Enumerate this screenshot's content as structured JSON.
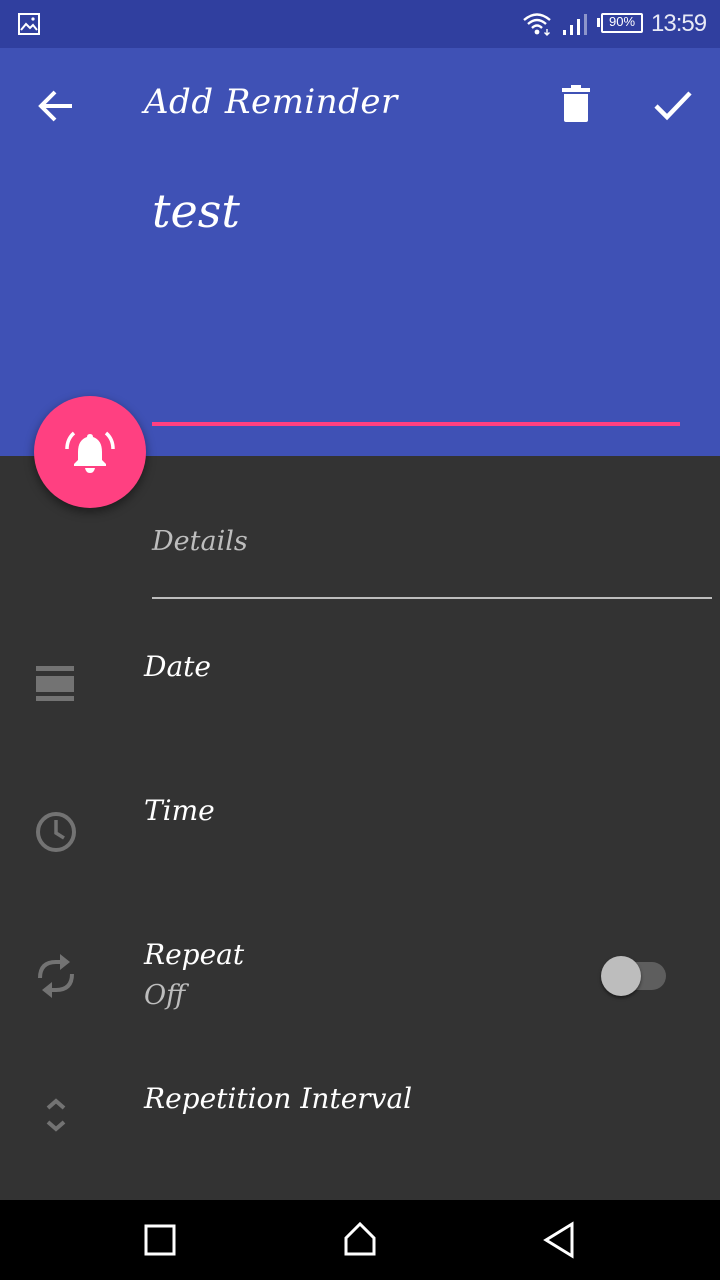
{
  "status_bar": {
    "time": "13:59",
    "battery": "90%",
    "icons": [
      "gallery-icon",
      "wifi-icon",
      "signal-icon",
      "battery-icon"
    ]
  },
  "toolbar": {
    "title": "Add Reminder",
    "back_icon": "arrow-back-icon",
    "delete_icon": "trash-icon",
    "save_icon": "check-icon"
  },
  "reminder": {
    "title_value": "test",
    "details_placeholder": "Details"
  },
  "fab": {
    "icon": "alarm-bell-icon"
  },
  "rows": {
    "date": {
      "label": "Date",
      "icon": "calendar-icon"
    },
    "time": {
      "label": "Time",
      "icon": "clock-icon"
    },
    "repeat": {
      "label": "Repeat",
      "value": "Off",
      "icon": "repeat-icon",
      "enabled": false
    },
    "interval": {
      "label": "Repetition Interval",
      "icon": "unfold-icon"
    }
  },
  "colors": {
    "primary": "#3f51b5",
    "primary_dark": "#303f9f",
    "accent": "#ff4081",
    "background": "#333333"
  },
  "nav_bar": {
    "icons": [
      "recents-icon",
      "home-icon",
      "back-icon"
    ]
  }
}
